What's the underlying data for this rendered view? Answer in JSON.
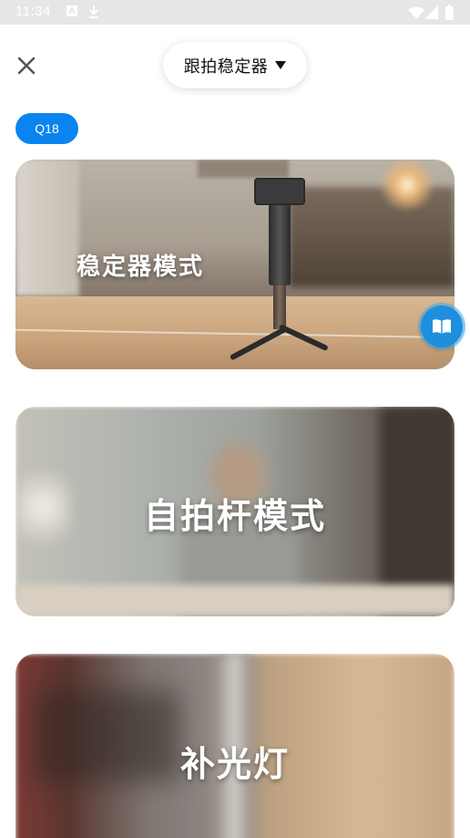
{
  "status_bar": {
    "time": "11:34",
    "icons": [
      "notification-a-icon",
      "download-icon",
      "wifi-icon",
      "cellular-icon",
      "battery-icon"
    ]
  },
  "header": {
    "close_icon": "close-icon",
    "mode_selector": {
      "label": "跟拍稳定器",
      "icon": "caret-down-icon"
    }
  },
  "model_badge": "Q18",
  "modes": [
    {
      "label": "稳定器模式"
    },
    {
      "label": "自拍杆模式"
    },
    {
      "label": "补光灯"
    }
  ],
  "floating_button": {
    "icon": "book-icon"
  },
  "colors": {
    "accent": "#0a84f0",
    "status_bar": "#e6e6e6",
    "guide_button": "#1d8fdc"
  }
}
